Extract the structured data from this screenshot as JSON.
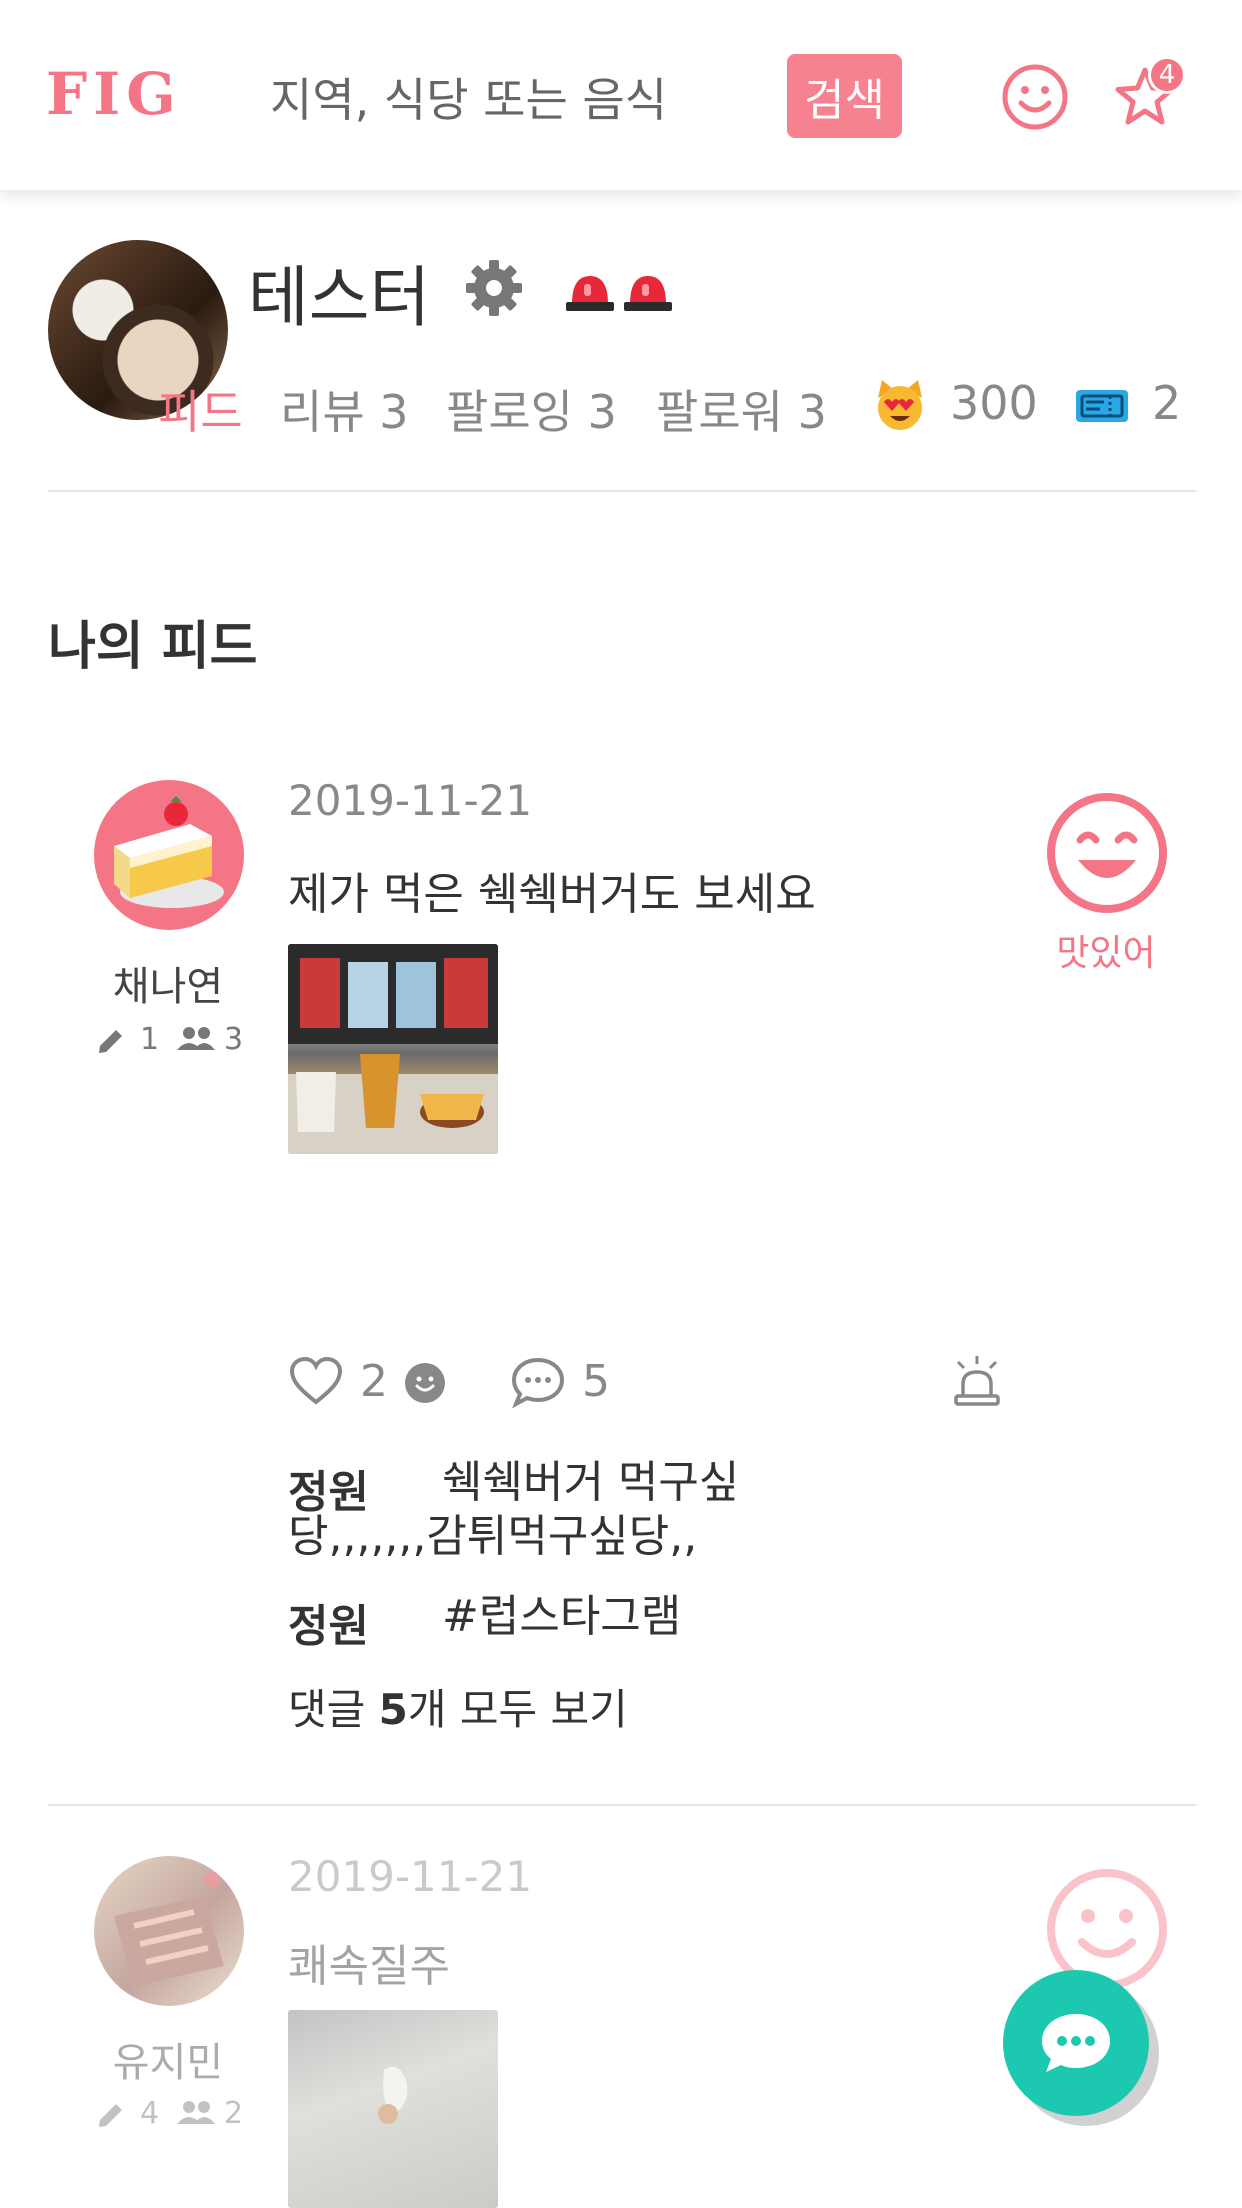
{
  "header": {
    "logo": "FIG",
    "search_placeholder": "지역, 식당 또는 음식",
    "search_button": "검색",
    "notification_count": "4"
  },
  "profile": {
    "name": "테스터",
    "tabs": {
      "feed": "피드",
      "reviews": "리뷰 3",
      "following": "팔로잉 3",
      "followers": "팔로워 3",
      "points": "300",
      "tickets": "2"
    }
  },
  "section_title": "나의 피드",
  "posts": [
    {
      "author": "채나연",
      "author_posts": "1",
      "author_friends": "3",
      "date": "2019-11-21",
      "text": "제가 먹은 쉑쉑버거도 보세요",
      "rating_label": "맛있어",
      "likes": "2",
      "comments": "5",
      "comment_list": [
        {
          "author": "정원",
          "text": "쉑쉑버거 먹구싶당,,,,,,,감튀먹구싶당,,"
        },
        {
          "author": "정원",
          "text": "#럽스타그램"
        }
      ],
      "view_all": {
        "prefix": "댓글 ",
        "count": "5",
        "suffix": "개 모두 보기"
      }
    },
    {
      "author": "유지민",
      "author_posts": "4",
      "author_friends": "2",
      "date": "2019-11-21",
      "text": "쾌속질주"
    }
  ],
  "colors": {
    "accent": "#f47686",
    "fab": "#1cc9b0"
  }
}
